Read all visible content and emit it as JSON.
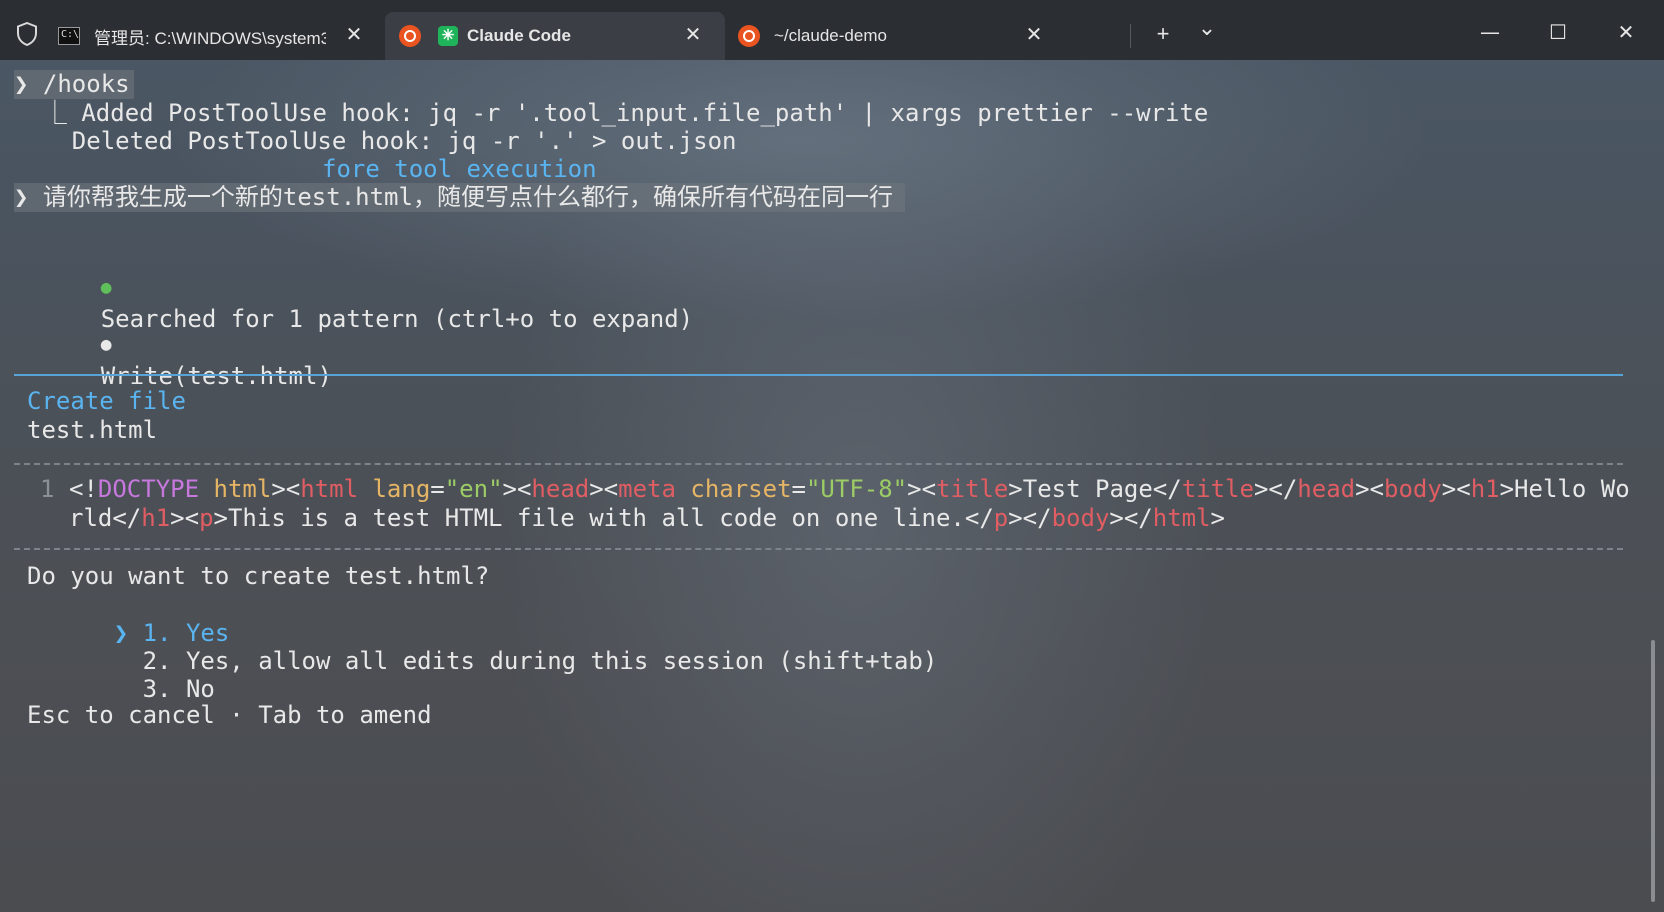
{
  "tabs": [
    {
      "title": "管理员: C:\\WINDOWS\\system3",
      "icon": "cmd-icon",
      "close": "✕"
    },
    {
      "title": "Claude Code",
      "icon": "claude-code-icon",
      "close": "✕"
    },
    {
      "title": "~/claude-demo",
      "icon": "ubuntu-icon",
      "close": "✕"
    }
  ],
  "tabbar": {
    "new_tab": "+",
    "dropdown": "⌄"
  },
  "window_controls": {
    "minimize": "—",
    "maximize": "☐",
    "close": "✕"
  },
  "terminal": {
    "hooks_prompt": "❯ /hooks",
    "hook_added": "  ⎿ Added PostToolUse hook: jq -r '.tool_input.file_path' | xargs prettier --write",
    "hook_deleted": "    Deleted PostToolUse hook: jq -r '.' > out.json",
    "hook_partial": "fore tool execution",
    "user_prompt": "❯ 请你帮我生成一个新的test.html，随便写点什么都行，确保所有代码在同一行",
    "search_bullet": "●",
    "search_text": "Searched for 1 pattern (ctrl+o to expand)",
    "write_bullet": "●",
    "write_text": "Write(test.html)",
    "create_title": "Create file",
    "create_filename": "test.html",
    "code_line_number": "1",
    "code_line1_tokens": [
      {
        "t": "<!",
        "c": "plain"
      },
      {
        "t": "DOCTYPE",
        "c": "doc"
      },
      {
        "t": " ",
        "c": "plain"
      },
      {
        "t": "html",
        "c": "attr"
      },
      {
        "t": "><",
        "c": "plain"
      },
      {
        "t": "html",
        "c": "tag"
      },
      {
        "t": " ",
        "c": "plain"
      },
      {
        "t": "lang",
        "c": "attr"
      },
      {
        "t": "=",
        "c": "plain"
      },
      {
        "t": "\"en\"",
        "c": "str"
      },
      {
        "t": "><",
        "c": "plain"
      },
      {
        "t": "head",
        "c": "tag"
      },
      {
        "t": "><",
        "c": "plain"
      },
      {
        "t": "meta",
        "c": "tag"
      },
      {
        "t": " ",
        "c": "plain"
      },
      {
        "t": "charset",
        "c": "attr"
      },
      {
        "t": "=",
        "c": "plain"
      },
      {
        "t": "\"UTF-8\"",
        "c": "str"
      },
      {
        "t": "><",
        "c": "plain"
      },
      {
        "t": "title",
        "c": "tag"
      },
      {
        "t": ">Test Page</",
        "c": "plain"
      },
      {
        "t": "title",
        "c": "tag"
      },
      {
        "t": "></",
        "c": "plain"
      },
      {
        "t": "head",
        "c": "tag"
      },
      {
        "t": "><",
        "c": "plain"
      },
      {
        "t": "body",
        "c": "tag"
      },
      {
        "t": "><",
        "c": "plain"
      },
      {
        "t": "h1",
        "c": "tag"
      },
      {
        "t": ">Hello Wo",
        "c": "plain"
      }
    ],
    "code_line2_tokens": [
      {
        "t": "rld</",
        "c": "plain"
      },
      {
        "t": "h1",
        "c": "tag"
      },
      {
        "t": "><",
        "c": "plain"
      },
      {
        "t": "p",
        "c": "tag"
      },
      {
        "t": ">This is a test HTML file with all code on one line.</",
        "c": "plain"
      },
      {
        "t": "p",
        "c": "tag"
      },
      {
        "t": "></",
        "c": "plain"
      },
      {
        "t": "body",
        "c": "tag"
      },
      {
        "t": "></",
        "c": "plain"
      },
      {
        "t": "html",
        "c": "tag"
      },
      {
        "t": ">",
        "c": "plain"
      }
    ],
    "question": "Do you want to create test.html?",
    "options": [
      {
        "pointer": "❯ ",
        "label": "1. Yes"
      },
      {
        "pointer": "  ",
        "label": "2. Yes, allow all edits during this session (shift+tab)"
      },
      {
        "pointer": "  ",
        "label": "3. No"
      }
    ],
    "footer": "Esc to cancel · Tab to amend"
  },
  "colors": {
    "accent_blue": "#5ab4f0",
    "success_green": "#5fbf5a",
    "tag_red": "#e05d63",
    "attr_yellow": "#e5b565",
    "string_green": "#9ccc65",
    "doctype_purple": "#c678dd"
  }
}
